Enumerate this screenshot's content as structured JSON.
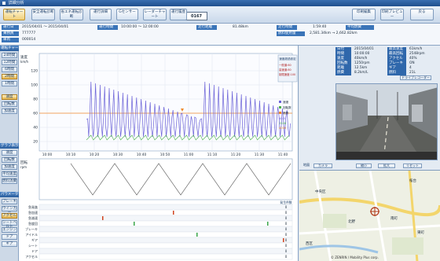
{
  "app": {
    "title": "詳細分析"
  },
  "toolbar": {
    "buttons": [
      "運転チャート",
      "安全運転診断",
      "省エネ運転診断",
      "運行詳細",
      "Gセンサー",
      "レーダーチャート",
      "運行履歴"
    ],
    "right_buttons": [
      "印刷編集",
      "印刷プレビュー",
      "戻る"
    ],
    "plate": "0167"
  },
  "info": {
    "labels": [
      "運行日",
      "乗務員",
      "車両",
      "運行時間",
      "走行距離",
      "走行時間",
      "燃料使用量",
      "平均燃費"
    ],
    "date_range": "2015/04/01 ～ 2015/04/01",
    "driver": "777777",
    "vehicle": "000014",
    "time_range": "10:00:00 ～ 12:00:00",
    "distance": "81.48km",
    "drive_time": "1:59:40",
    "fuel": "2,581.34km → 2,662.82km"
  },
  "sidebar": {
    "chart_header": "運転チャート",
    "range_buttons": [
      "24時間",
      "12時間",
      "6時間",
      "2時間",
      "1時間"
    ],
    "mode_buttons": [
      "速度",
      "回転数",
      "加速度"
    ],
    "graph_header": "グラフ表示",
    "graph_buttons": [
      "速度",
      "回転数",
      "加速度",
      "平均速度",
      "燃料消費"
    ],
    "param_header": "パラメータ",
    "param_buttons": [
      "ブレーキ",
      "ウインカー",
      "アクセル",
      "シートベルト",
      "エンジン",
      "ドア",
      "ギア"
    ]
  },
  "chart": {
    "speed_axis_label": "速度",
    "speed_unit": "km/h",
    "y_ticks": [
      "120",
      "100",
      "80",
      "60",
      "40",
      "20"
    ],
    "x_ticks": [
      "10:00",
      "10:10",
      "10:20",
      "10:30",
      "10:40",
      "10:50",
      "11:00",
      "11:10",
      "11:20",
      "11:30",
      "11:40"
    ],
    "legend": [
      "速度",
      "回転数",
      "燃費"
    ],
    "legend_values": [
      "40.5",
      "2548",
      "4000"
    ],
    "rpm_label": "回転",
    "rpm_unit": "rpm",
    "event_rows": [
      "急発進",
      "急加速",
      "急減速",
      "急旋回",
      "ブレーキ",
      "アイドル",
      "ギア",
      "シート",
      "ドア",
      "アクセル"
    ],
    "event_header": "発生件数",
    "event_counts": [
      "0",
      "0",
      "0",
      "0",
      "0",
      "0",
      "0",
      "0",
      "0",
      "0"
    ]
  },
  "speed_panel": {
    "title": "速度超過設定",
    "lines": [
      "一般道:60",
      "高速道:80",
      "制限速度:100"
    ]
  },
  "right_panel": {
    "stats": [
      {
        "k": "日付",
        "v": "2015/04/01"
      },
      {
        "k": "時間",
        "v": "10:00:00"
      },
      {
        "k": "速度",
        "v": "40km/h"
      },
      {
        "k": "回転数",
        "v": "1250rpm"
      },
      {
        "k": "距離",
        "v": "12.5km"
      },
      {
        "k": "燃費",
        "v": "8.2km/L"
      }
    ],
    "stats_right": [
      {
        "k": "最高速度",
        "v": "61km/h"
      },
      {
        "k": "最高回転",
        "v": "2548rpm"
      },
      {
        "k": "アクセル",
        "v": "40%"
      },
      {
        "k": "ブレーキ",
        "v": "ON"
      },
      {
        "k": "ギア",
        "v": "4"
      },
      {
        "k": "燃料",
        "v": "21L"
      }
    ],
    "camera_button": "ドライブレコーダー",
    "map_tabs": [
      "地図",
      "カメラ",
      "縮小",
      "拡大",
      "リセット"
    ],
    "map_labels": [
      "桜台",
      "中央区",
      "北野",
      "南町",
      "東町",
      "西区"
    ],
    "copyright": "© ZENRIN / Mobility Plus corp."
  },
  "colors": {
    "accent": "#2f67ab",
    "speed": "#6c63d8",
    "rpm": "#4caf50",
    "limit": "#f08a2c"
  }
}
